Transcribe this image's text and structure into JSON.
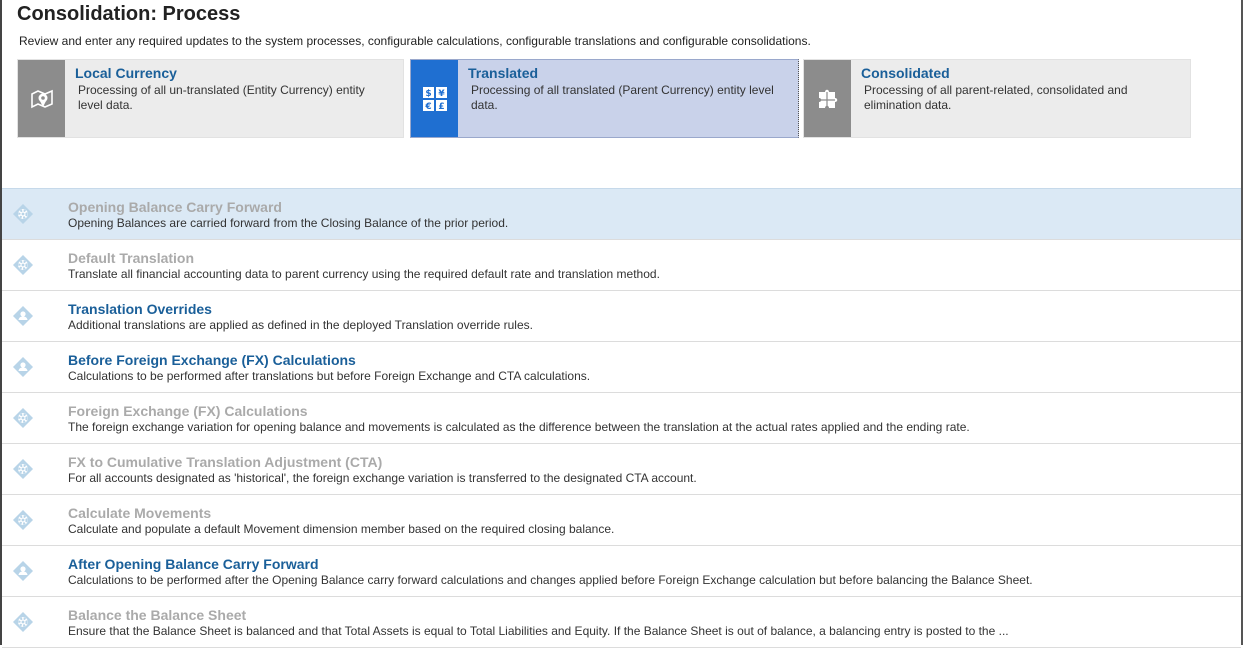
{
  "header": {
    "title": "Consolidation: Process",
    "description": "Review and enter any required updates to the system processes, configurable calculations, configurable translations and configurable consolidations."
  },
  "cards": [
    {
      "title": "Local Currency",
      "text": "Processing of all un-translated (Entity Currency) entity level data.",
      "icon": "location-pin-icon",
      "selected": false
    },
    {
      "title": "Translated",
      "text": "Processing of all translated (Parent Currency) entity level data.",
      "icon": "currency-exchange-icon",
      "selected": true
    },
    {
      "title": "Consolidated",
      "text": "Processing of all parent-related, consolidated and elimination data.",
      "icon": "puzzle-icon",
      "selected": false
    }
  ],
  "processes": [
    {
      "title": "Opening Balance Carry Forward",
      "desc": "Opening Balances are carried forward from the Closing Balance of the prior period.",
      "icon": "gear-icon",
      "enabled": false,
      "active": true
    },
    {
      "title": "Default Translation",
      "desc": "Translate all financial accounting data to parent currency using the required default rate and translation method.",
      "icon": "gear-icon",
      "enabled": false,
      "active": false
    },
    {
      "title": "Translation Overrides",
      "desc": "Additional translations are applied as defined in the deployed Translation override rules.",
      "icon": "user-rule-icon",
      "enabled": true,
      "active": false
    },
    {
      "title": "Before Foreign Exchange (FX) Calculations",
      "desc": "Calculations to be performed after translations but before Foreign Exchange and CTA calculations.",
      "icon": "user-rule-icon",
      "enabled": true,
      "active": false
    },
    {
      "title": "Foreign Exchange (FX) Calculations",
      "desc": "The foreign exchange variation for opening balance and movements is calculated as the difference between the translation at the actual rates applied and the ending rate.",
      "icon": "gear-icon",
      "enabled": false,
      "active": false
    },
    {
      "title": "FX to Cumulative Translation Adjustment (CTA)",
      "desc": "For all accounts designated as 'historical', the foreign exchange variation is transferred to the designated CTA account.",
      "icon": "gear-icon",
      "enabled": false,
      "active": false
    },
    {
      "title": "Calculate Movements",
      "desc": "Calculate and populate a default Movement dimension member based on the required closing balance.",
      "icon": "gear-icon",
      "enabled": false,
      "active": false
    },
    {
      "title": "After Opening Balance Carry Forward",
      "desc": "Calculations to be performed after the Opening Balance carry forward calculations and changes applied before Foreign Exchange calculation but before balancing the Balance Sheet.",
      "icon": "user-rule-icon",
      "enabled": true,
      "active": false
    },
    {
      "title": "Balance the Balance Sheet",
      "desc": "Ensure that the Balance Sheet is balanced and that Total Assets is equal to Total Liabilities and Equity. If the Balance Sheet is out of balance, a balancing entry is posted to the ...",
      "icon": "gear-icon",
      "enabled": false,
      "active": false
    }
  ],
  "colors": {
    "accent": "#1a5f99",
    "selected_icon_bg": "#1f6fd1",
    "selected_card_bg": "#c9d2ea",
    "card_bg": "#ececec",
    "icon_bg": "#8c8c8c",
    "active_row_bg": "#dbe9f5",
    "disabled_title": "#aaaaaa"
  }
}
